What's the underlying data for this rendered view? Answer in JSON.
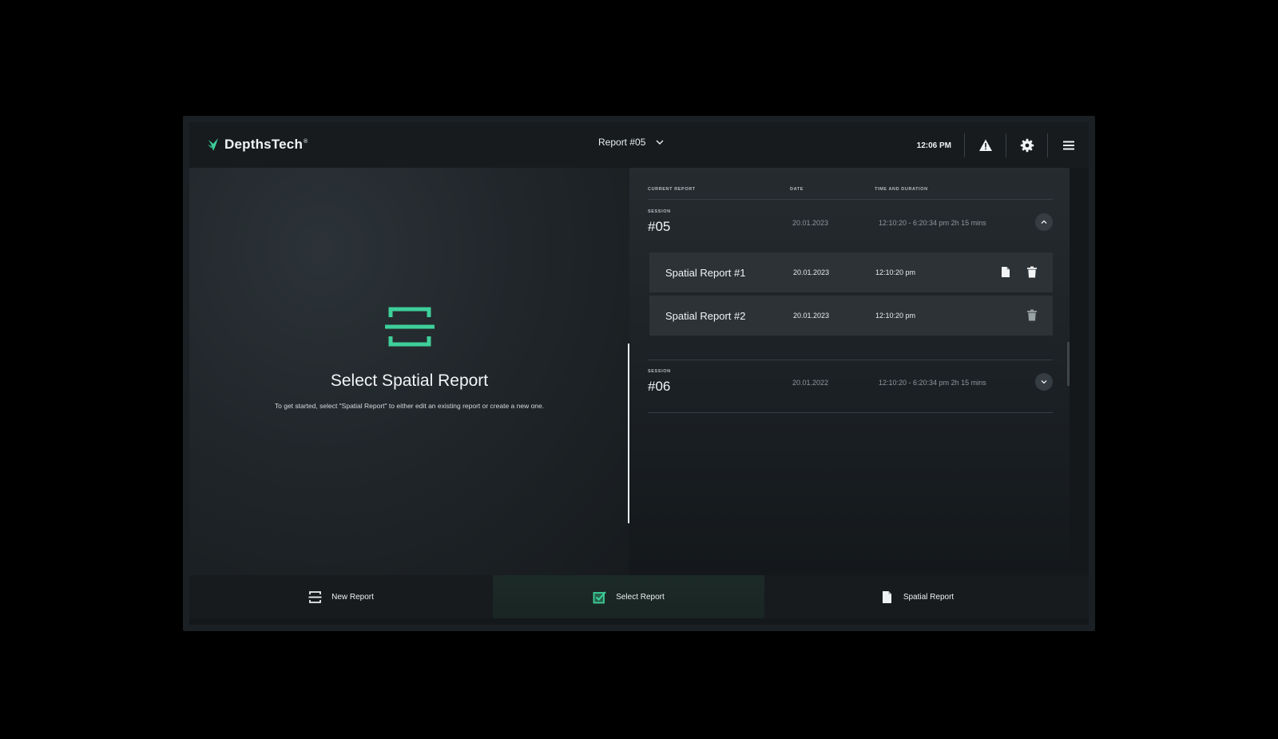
{
  "header": {
    "logo_text": "DepthsTech",
    "logo_reg": "®",
    "report_selector": "Report #05",
    "clock": "12:06 PM",
    "icons": [
      "warning-icon",
      "gear-icon",
      "hamburger-menu-icon"
    ]
  },
  "left_panel": {
    "title": "Select Spatial Report",
    "subtitle": "To get started, select \"Spatial Report\" to either edit an existing report or create a new one.",
    "icon": "report-stack-icon"
  },
  "table": {
    "columns": [
      "CURRENT REPORT",
      "DATE",
      "TIME AND DURATION"
    ],
    "sessions": [
      {
        "label": "SESSION",
        "number": "#05",
        "date": "20.01.2023",
        "time": "12:10:20 - 6:20:34 pm  2h 15 mins",
        "expanded": true,
        "reports": [
          {
            "name": "Spatial Report #1",
            "date": "20.01.2023",
            "time": "12:10:20 pm",
            "has_file": true
          },
          {
            "name": "Spatial Report #2",
            "date": "20.01.2023",
            "time": "12:10:20 pm",
            "has_file": false
          }
        ]
      },
      {
        "label": "SESSION",
        "number": "#06",
        "date": "20.01.2022",
        "time": "12:10:20 - 6:20:34 pm  2h 15 mins",
        "expanded": false,
        "reports": []
      }
    ]
  },
  "bottom_nav": {
    "new_report": "New Report",
    "select_report": "Select Report",
    "spatial_report": "Spatial Report",
    "active": "Select Report"
  },
  "colors": {
    "accent": "#3ecf9a",
    "background": "#14181b",
    "panel": "#2c3236"
  }
}
